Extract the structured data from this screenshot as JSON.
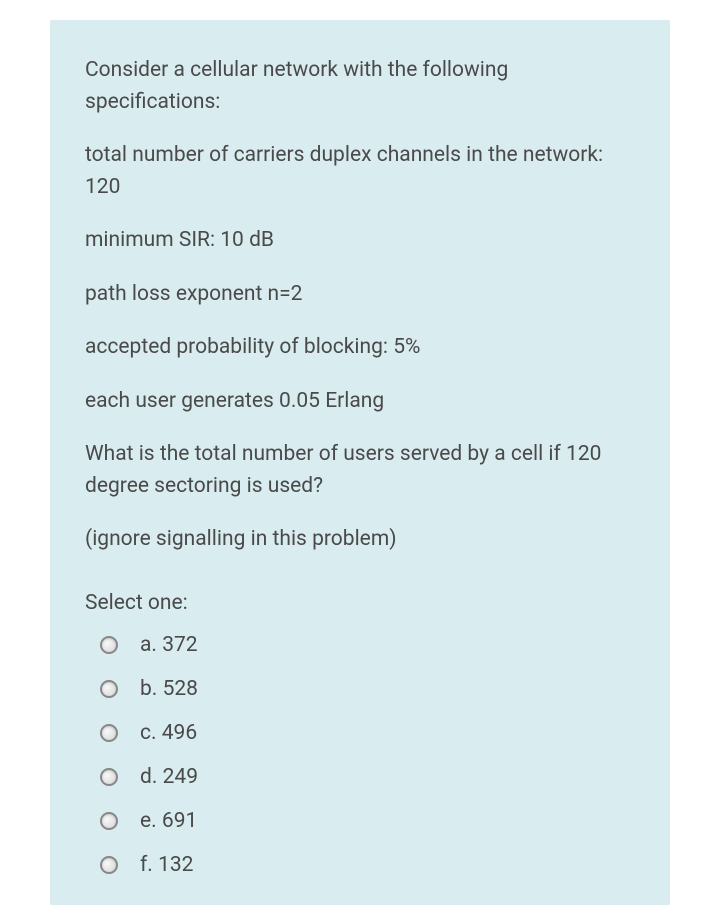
{
  "question": {
    "paragraphs": [
      "Consider a cellular network with the following specifications:",
      "total number of carriers duplex channels in the network: 120",
      "minimum SIR: 10 dB",
      "path loss exponent n=2",
      "accepted probability of blocking: 5%",
      "each user generates 0.05 Erlang",
      "What is the total number of users served by a cell if 120 degree sectoring is used?",
      "(ignore signalling in this problem)"
    ],
    "select_label": "Select one:",
    "options": [
      {
        "letter": "a.",
        "value": "372"
      },
      {
        "letter": "b.",
        "value": "528"
      },
      {
        "letter": "c.",
        "value": "496"
      },
      {
        "letter": "d.",
        "value": "249"
      },
      {
        "letter": "e.",
        "value": "691"
      },
      {
        "letter": "f.",
        "value": "132"
      }
    ]
  }
}
